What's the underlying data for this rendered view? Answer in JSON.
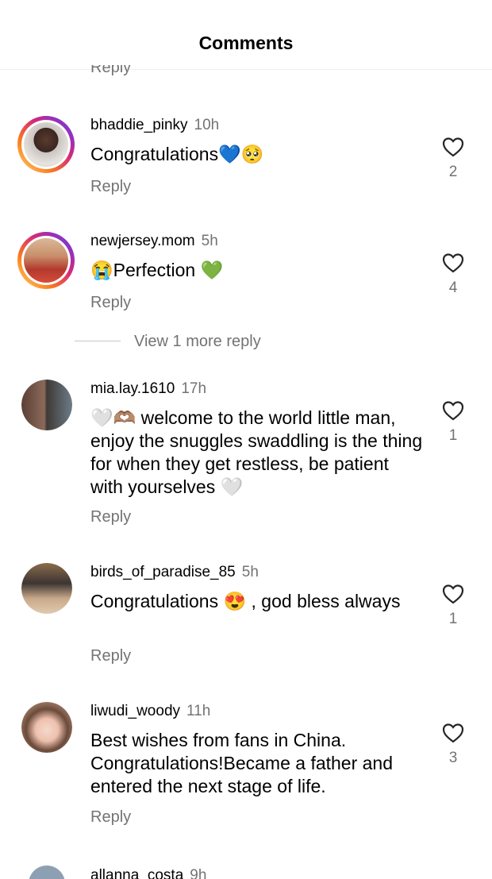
{
  "header": {
    "title": "Comments"
  },
  "partial_reply_label": "Reply",
  "comments": [
    {
      "username": "bhaddie_pinky",
      "time": "10h",
      "text": "Congratulations💙🥺",
      "reply_label": "Reply",
      "likes": "2",
      "story_ring": true
    },
    {
      "username": "newjersey.mom",
      "time": "5h",
      "text": "😭Perfection 💚",
      "reply_label": "Reply",
      "likes": "4",
      "story_ring": true
    },
    {
      "username": "mia.lay.1610",
      "time": "17h",
      "text": "🤍🫶🏽 welcome to the world little man, enjoy the snuggles swaddling is the thing for when they get restless, be patient with yourselves 🤍",
      "reply_label": "Reply",
      "likes": "1",
      "story_ring": false
    },
    {
      "username": "birds_of_paradise_85",
      "time": "5h",
      "text": "Congratulations 😍 , god bless always",
      "reply_label": "Reply",
      "likes": "1",
      "story_ring": false
    },
    {
      "username": "liwudi_woody",
      "time": "11h",
      "text": "Best wishes from fans in China. Congratulations!Became a father and entered the next stage of life.",
      "reply_label": "Reply",
      "likes": "3",
      "story_ring": false
    }
  ],
  "view_more_replies": "View 1 more reply",
  "cutoff_comment": {
    "username": "allanna_costa",
    "time": "9h"
  },
  "colors": {
    "secondary_text": "#737373",
    "ring_start": "#feda75",
    "ring_end": "#962fbf"
  }
}
